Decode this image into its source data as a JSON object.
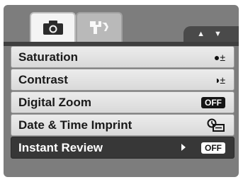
{
  "tabs": {
    "camera": {
      "icon": "camera-icon"
    },
    "setup": {
      "icon": "wrench-icon"
    }
  },
  "nav": {
    "label": "▲ ▼"
  },
  "menu": [
    {
      "label": "Saturation",
      "value_icon": "saturation-adjust-icon",
      "value_text": "●±"
    },
    {
      "label": "Contrast",
      "value_icon": "contrast-adjust-icon",
      "value_text": "◑±"
    },
    {
      "label": "Digital Zoom",
      "value_text": "OFF"
    },
    {
      "label": "Date & Time Imprint",
      "value_icon": "date-imprint-icon"
    },
    {
      "label": "Instant Review",
      "value_text": "OFF",
      "selected": true
    }
  ],
  "colors": {
    "selected_row": "#373737",
    "screen_bg": "#7d7d7d"
  }
}
